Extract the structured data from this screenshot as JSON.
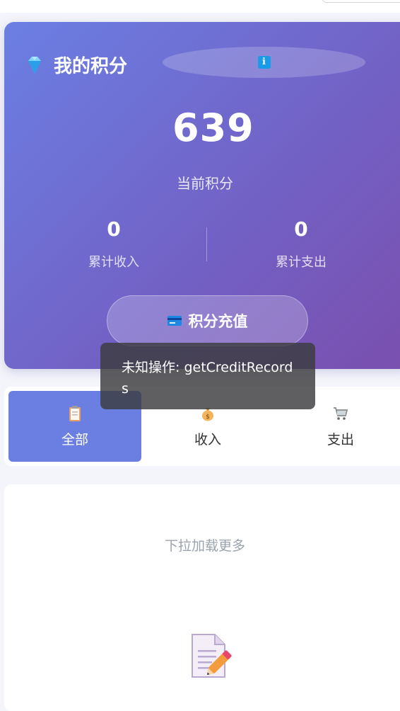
{
  "points": {
    "title": "我的积分",
    "current_value": "639",
    "current_label": "当前积分",
    "total_income_value": "0",
    "total_income_label": "累计收入",
    "total_expense_value": "0",
    "total_expense_label": "累计支出",
    "recharge_label": "积分充值"
  },
  "toast": {
    "message": "未知操作: getCreditRecords"
  },
  "tabs": [
    {
      "label": "全部",
      "icon": "clipboard-icon",
      "active": true
    },
    {
      "label": "收入",
      "icon": "money-bag-icon",
      "active": false
    },
    {
      "label": "支出",
      "icon": "cart-icon",
      "active": false
    }
  ],
  "list": {
    "load_more": "下拉加载更多",
    "empty_icon": "memo-icon"
  },
  "colors": {
    "accent": "#6b7fe3",
    "gradient_end": "#7a4fae"
  }
}
